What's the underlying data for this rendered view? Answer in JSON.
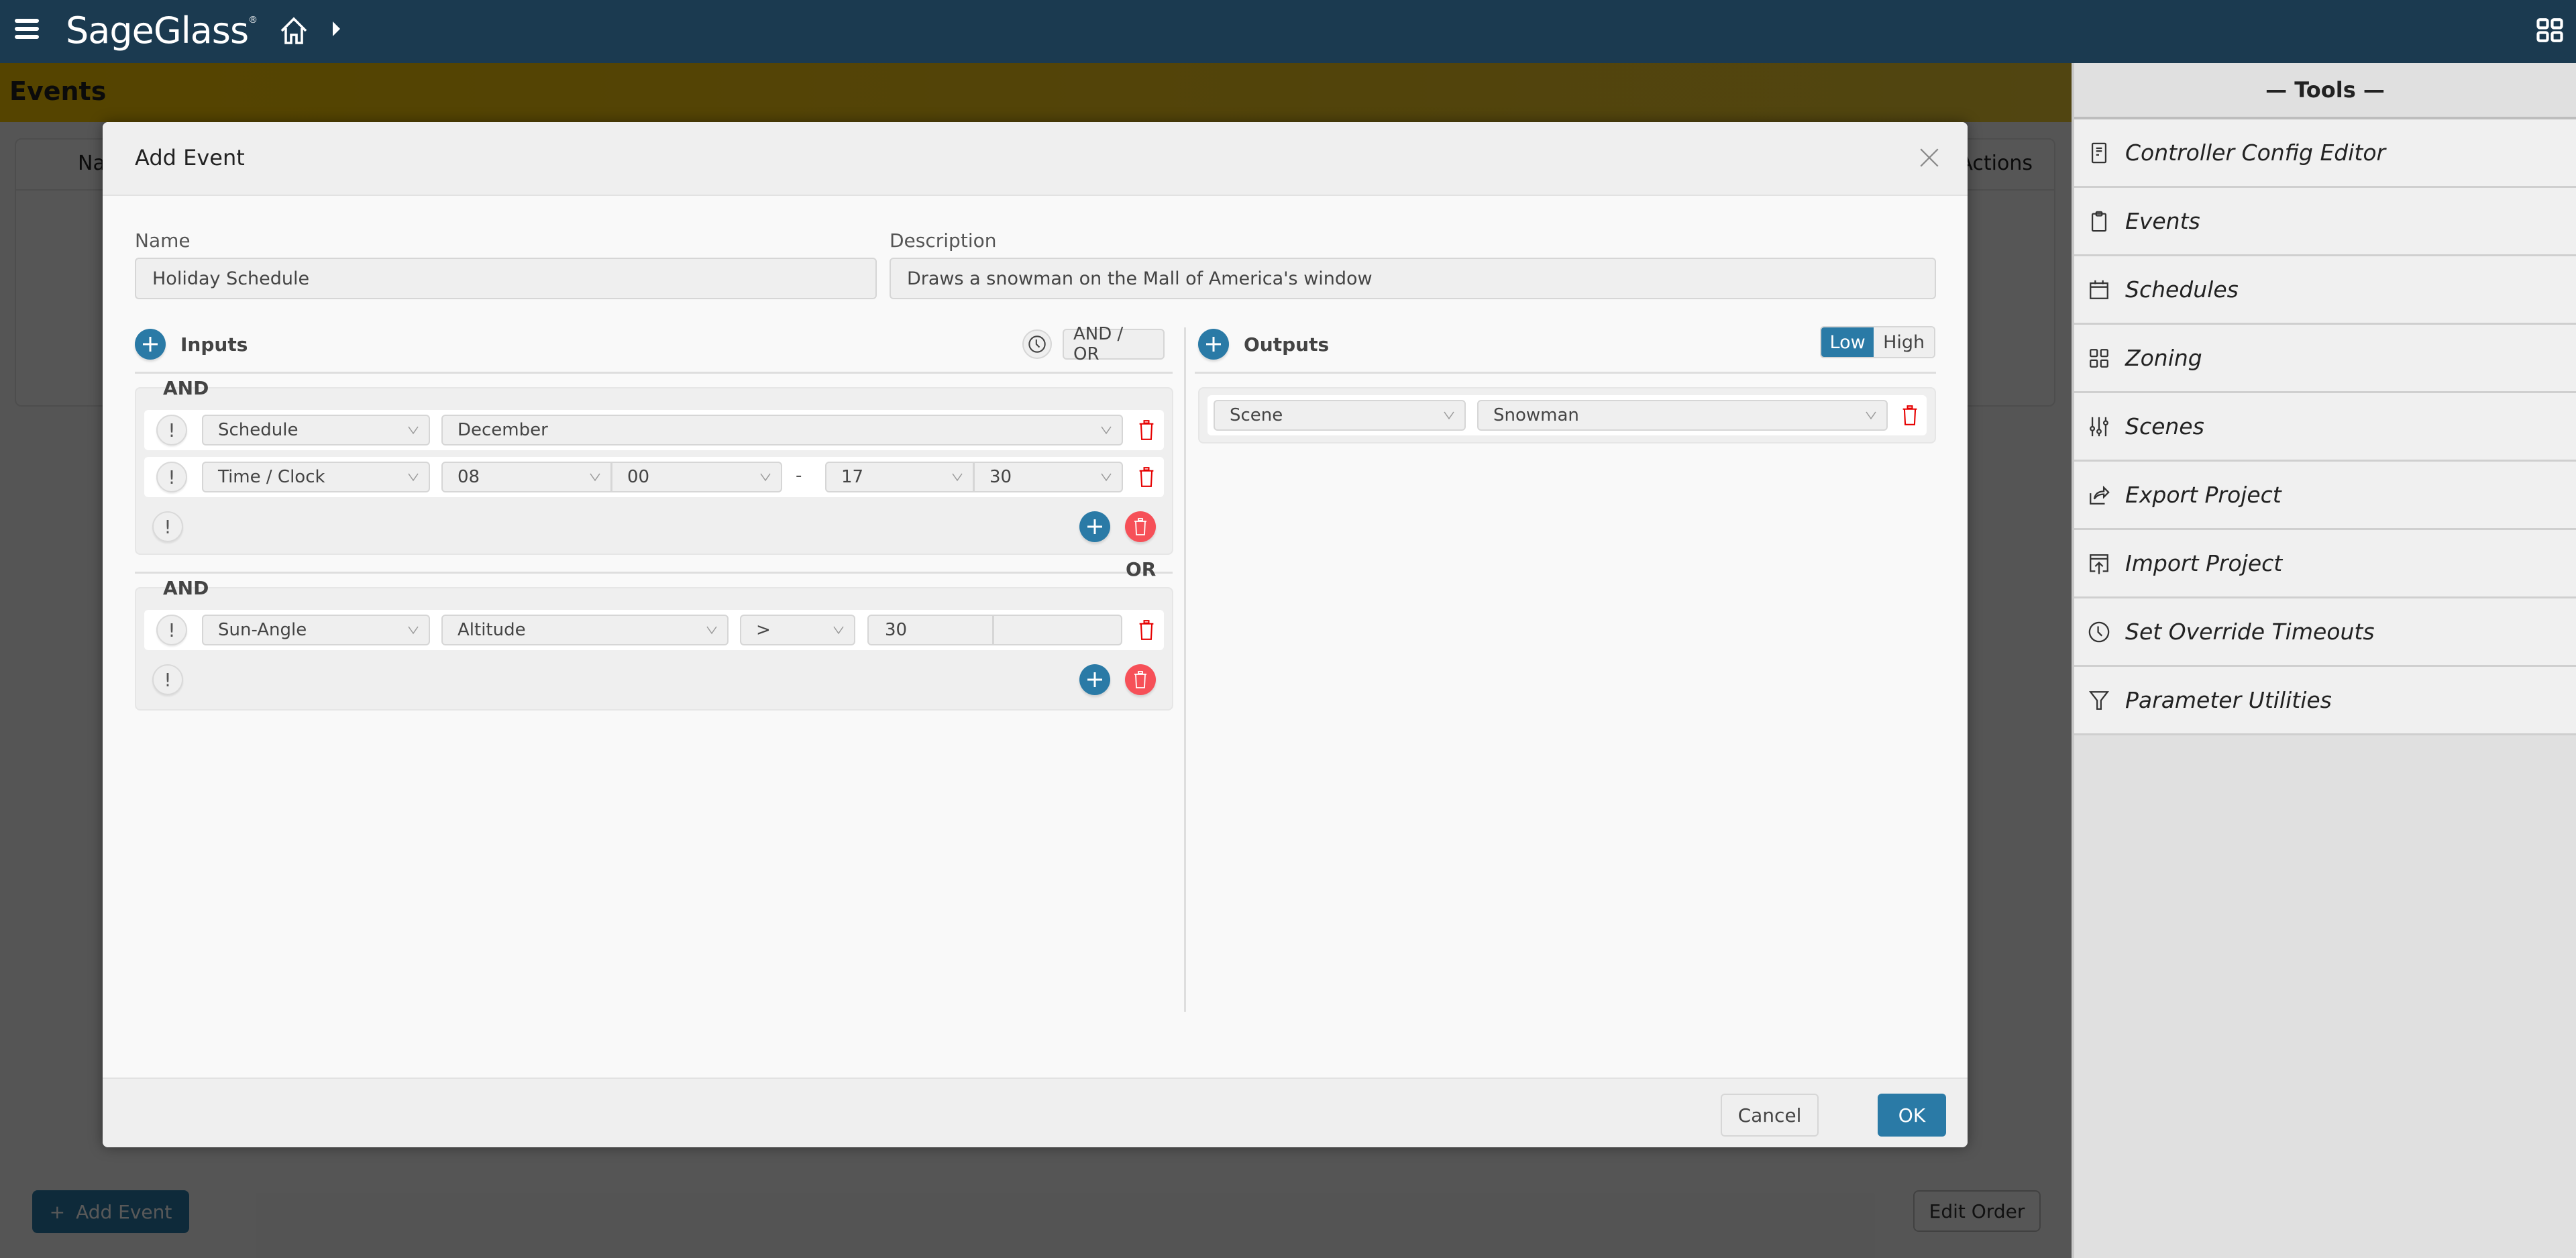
{
  "app": {
    "brand": "SageGlass",
    "brand_mark": "®"
  },
  "page": {
    "title": "Events",
    "table_headers": {
      "name": "Name",
      "actions": "Actions"
    },
    "add_event_label": "Add Event",
    "edit_order_label": "Edit Order"
  },
  "tools": {
    "header": "— Tools —",
    "items": [
      {
        "label": "Controller Config Editor",
        "icon": "document-icon"
      },
      {
        "label": "Events",
        "icon": "clipboard-icon"
      },
      {
        "label": "Schedules",
        "icon": "calendar-icon"
      },
      {
        "label": "Zoning",
        "icon": "grid-icon"
      },
      {
        "label": "Scenes",
        "icon": "sliders-icon"
      },
      {
        "label": "Export Project",
        "icon": "export-icon"
      },
      {
        "label": "Import Project",
        "icon": "import-icon"
      },
      {
        "label": "Set Override Timeouts",
        "icon": "clock-icon"
      },
      {
        "label": "Parameter Utilities",
        "icon": "filter-icon"
      }
    ]
  },
  "modal": {
    "title": "Add Event",
    "name_label": "Name",
    "name_value": "Holiday Schedule",
    "description_label": "Description",
    "description_value": "Draws a snowman on the Mall of America's window",
    "inputs": {
      "title": "Inputs",
      "andor_label": "AND / OR",
      "or_separator": "OR",
      "groups": [
        {
          "operator": "AND",
          "rows": [
            {
              "negate": "!",
              "type": "Schedule",
              "value": "December"
            },
            {
              "negate": "!",
              "type": "Time / Clock",
              "start_hour": "08",
              "start_minute": "00",
              "separator": "-",
              "end_hour": "17",
              "end_minute": "30"
            }
          ],
          "negate": "!"
        },
        {
          "operator": "AND",
          "rows": [
            {
              "negate": "!",
              "type": "Sun-Angle",
              "attribute": "Altitude",
              "comparator": ">",
              "value": "30",
              "value2": ""
            }
          ],
          "negate": "!"
        }
      ]
    },
    "outputs": {
      "title": "Outputs",
      "toggle": {
        "low": "Low",
        "high": "High",
        "selected": "Low"
      },
      "rows": [
        {
          "type": "Scene",
          "value": "Snowman"
        }
      ]
    },
    "cancel_label": "Cancel",
    "ok_label": "OK"
  },
  "colors": {
    "topbar": "#1b3a50",
    "accent": "#2a7aa6",
    "danger": "#f65058",
    "trash": "#e60000",
    "page_header": "#f3c300"
  }
}
